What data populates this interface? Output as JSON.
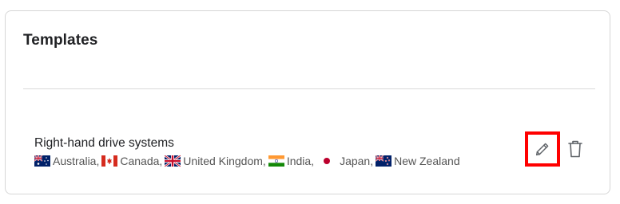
{
  "panel": {
    "title": "Templates"
  },
  "template": {
    "name": "Right-hand drive systems",
    "countries": [
      {
        "flag": "au-flag-icon",
        "label": "Australia,"
      },
      {
        "flag": "ca-flag-icon",
        "label": "Canada,"
      },
      {
        "flag": "gb-flag-icon",
        "label": "United Kingdom,"
      },
      {
        "flag": "in-flag-icon",
        "label": "India,"
      },
      {
        "flag": "jp-flag-icon",
        "label": "Japan,"
      },
      {
        "flag": "nz-flag-icon",
        "label": "New Zealand"
      }
    ],
    "actions": {
      "edit_icon": "pencil-icon",
      "delete_icon": "trash-icon",
      "highlight_color": "#ff0000"
    }
  }
}
